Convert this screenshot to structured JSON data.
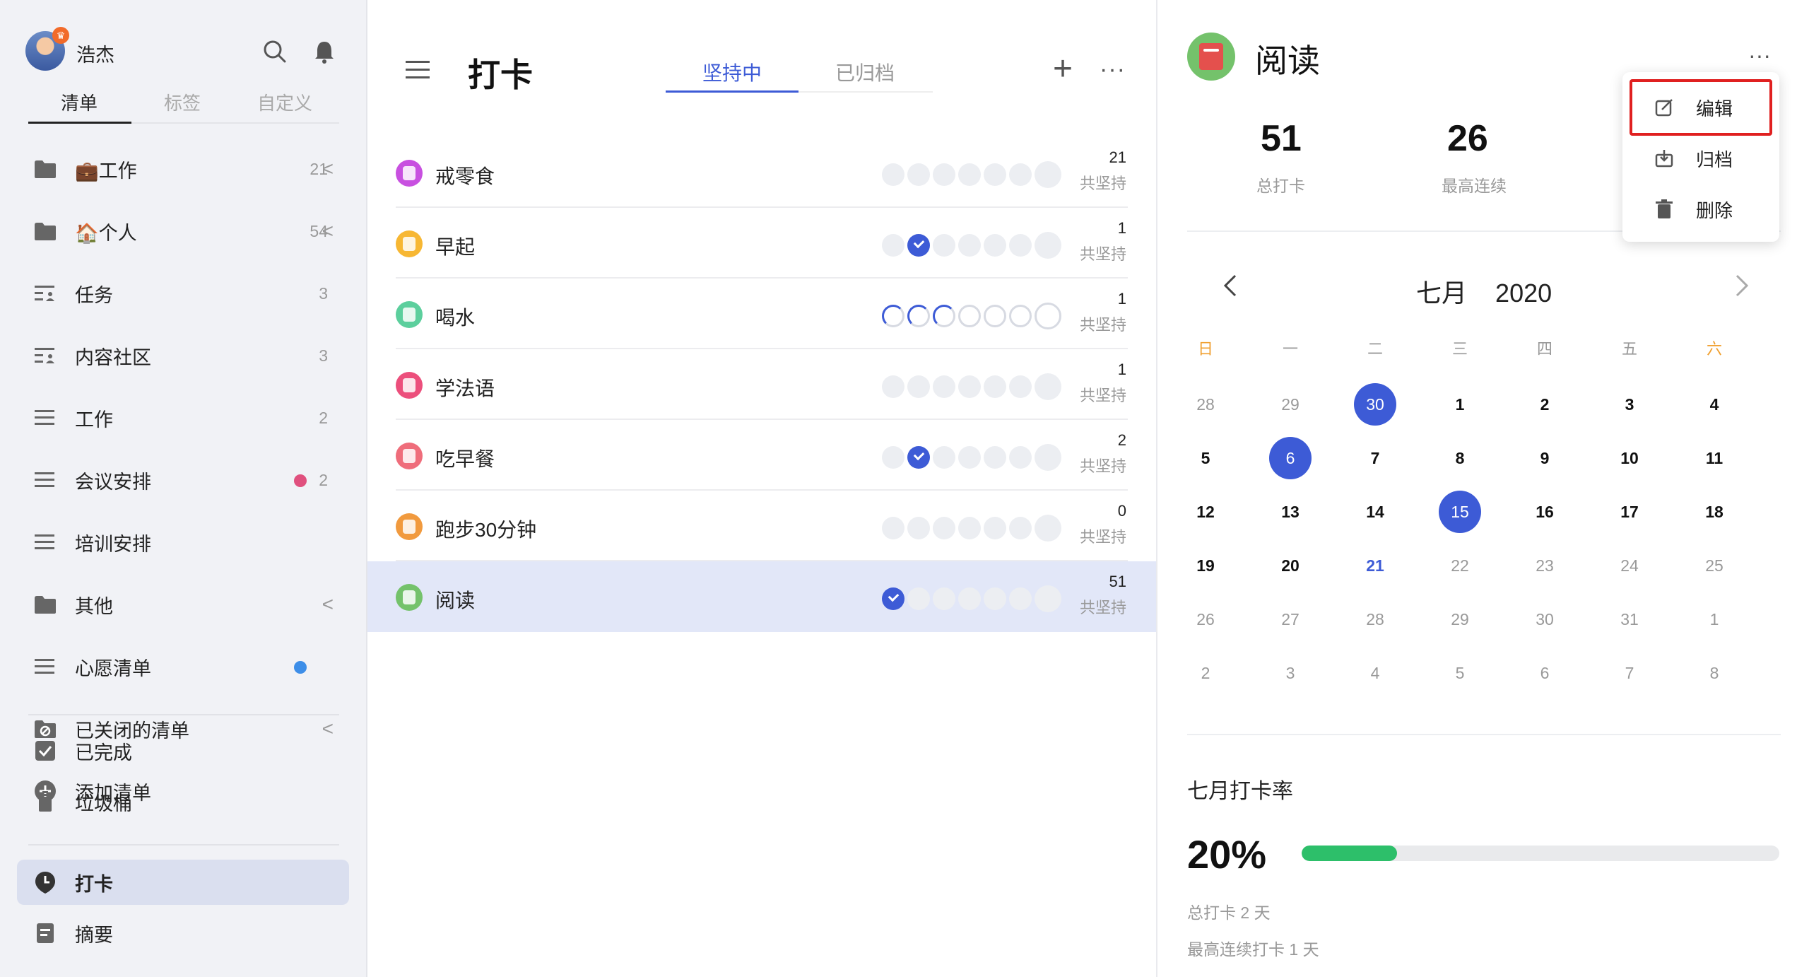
{
  "user": {
    "name": "浩杰"
  },
  "sidebar": {
    "tabs": [
      "清单",
      "标签",
      "自定义"
    ],
    "items": [
      {
        "label": "💼工作",
        "count": "21",
        "chevron": "<",
        "icon": "folder-icon"
      },
      {
        "label": "🏠个人",
        "count": "54",
        "chevron": "<",
        "icon": "folder-icon"
      },
      {
        "label": "任务",
        "count": "3",
        "icon": "list-icon"
      },
      {
        "label": "内容社区",
        "count": "3",
        "icon": "list-icon"
      },
      {
        "label": "工作",
        "count": "2",
        "icon": "menu-icon"
      },
      {
        "label": "会议安排",
        "count": "2",
        "icon": "menu-icon",
        "dot": "#e0507e"
      },
      {
        "label": "培训安排",
        "icon": "menu-icon"
      },
      {
        "label": "其他",
        "chevron": "<",
        "icon": "folder-icon"
      },
      {
        "label": "心愿清单",
        "icon": "menu-icon",
        "dot": "#3d8ee8"
      },
      {
        "label": "已关闭的清单",
        "chevron": "<",
        "icon": "closed-folder-icon"
      },
      {
        "label": "添加清单",
        "icon": "plus-circle-icon"
      }
    ],
    "bottom": [
      {
        "label": "已完成",
        "icon": "checkbox-icon"
      },
      {
        "label": "垃圾桶",
        "icon": "trash-icon"
      },
      {
        "label": "打卡",
        "icon": "habit-icon"
      },
      {
        "label": "摘要",
        "icon": "summary-icon"
      }
    ]
  },
  "middle": {
    "title": "打卡",
    "tabs": [
      "坚持中",
      "已归档"
    ],
    "plus": "+",
    "more": "···",
    "habits": [
      {
        "name": "戒零食",
        "count": "21",
        "caption": "共坚持",
        "color": "#c850e0",
        "days": [
          "",
          "",
          "",
          "",
          "",
          "",
          "today"
        ]
      },
      {
        "name": "早起",
        "count": "1",
        "caption": "共坚持",
        "color": "#f7b733",
        "days": [
          "",
          "checked",
          "",
          "",
          "",
          "",
          "today"
        ]
      },
      {
        "name": "喝水",
        "count": "1",
        "caption": "共坚持",
        "color": "#5ccf9d",
        "days": [
          "spin",
          "spin",
          "spin",
          "ring",
          "ring",
          "ring",
          "ring-today"
        ]
      },
      {
        "name": "学法语",
        "count": "1",
        "caption": "共坚持",
        "color": "#ec4f7c",
        "days": [
          "",
          "",
          "",
          "",
          "",
          "",
          "today"
        ]
      },
      {
        "name": "吃早餐",
        "count": "2",
        "caption": "共坚持",
        "color": "#ef6d7b",
        "days": [
          "",
          "checked",
          "",
          "",
          "",
          "",
          "today"
        ]
      },
      {
        "name": "跑步30分钟",
        "count": "0",
        "caption": "共坚持",
        "color": "#f19a3e",
        "days": [
          "",
          "",
          "",
          "",
          "",
          "",
          "today"
        ]
      },
      {
        "name": "阅读",
        "count": "51",
        "caption": "共坚持",
        "color": "#74c26b",
        "days": [
          "checked",
          "",
          "",
          "",
          "",
          "",
          "today"
        ]
      }
    ]
  },
  "detail": {
    "title": "阅读",
    "more": "···",
    "stats": [
      {
        "value": "51",
        "label": "总打卡"
      },
      {
        "value": "26",
        "label": "最高连续"
      }
    ],
    "calendar": {
      "month_label": "七月",
      "year": "2020",
      "prev": "<",
      "next": ">",
      "weekdays": [
        "日",
        "一",
        "二",
        "三",
        "四",
        "五",
        "六"
      ],
      "rows": [
        [
          [
            "28",
            "o"
          ],
          [
            "29",
            "o"
          ],
          [
            "30",
            "d"
          ],
          [
            "1",
            "c"
          ],
          [
            "2",
            "c"
          ],
          [
            "3",
            "c"
          ],
          [
            "4",
            "c"
          ]
        ],
        [
          [
            "5",
            "c"
          ],
          [
            "6",
            "d"
          ],
          [
            "7",
            "c"
          ],
          [
            "8",
            "c"
          ],
          [
            "9",
            "c"
          ],
          [
            "10",
            "c"
          ],
          [
            "11",
            "c"
          ]
        ],
        [
          [
            "12",
            "c"
          ],
          [
            "13",
            "c"
          ],
          [
            "14",
            "c"
          ],
          [
            "15",
            "d"
          ],
          [
            "16",
            "c"
          ],
          [
            "17",
            "c"
          ],
          [
            "18",
            "c"
          ]
        ],
        [
          [
            "19",
            "c"
          ],
          [
            "20",
            "c"
          ],
          [
            "21",
            "t"
          ],
          [
            "22",
            "o"
          ],
          [
            "23",
            "o"
          ],
          [
            "24",
            "o"
          ],
          [
            "25",
            "o"
          ]
        ],
        [
          [
            "26",
            "o"
          ],
          [
            "27",
            "o"
          ],
          [
            "28",
            "o"
          ],
          [
            "29",
            "o"
          ],
          [
            "30",
            "o"
          ],
          [
            "31",
            "o"
          ],
          [
            "1",
            "o"
          ]
        ],
        [
          [
            "2",
            "o"
          ],
          [
            "3",
            "o"
          ],
          [
            "4",
            "o"
          ],
          [
            "5",
            "o"
          ],
          [
            "6",
            "o"
          ],
          [
            "7",
            "o"
          ],
          [
            "8",
            "o"
          ]
        ]
      ]
    },
    "rate": {
      "title": "七月打卡率",
      "value": "20%",
      "fraction": 0.2,
      "line1": "总打卡 2 天",
      "line2": "最高连续打卡 1 天",
      "color": "#2dbf6a"
    }
  },
  "menu": {
    "items": [
      {
        "label": "编辑",
        "icon": "edit-icon"
      },
      {
        "label": "归档",
        "icon": "archive-icon"
      },
      {
        "label": "删除",
        "icon": "trash-icon"
      }
    ]
  }
}
